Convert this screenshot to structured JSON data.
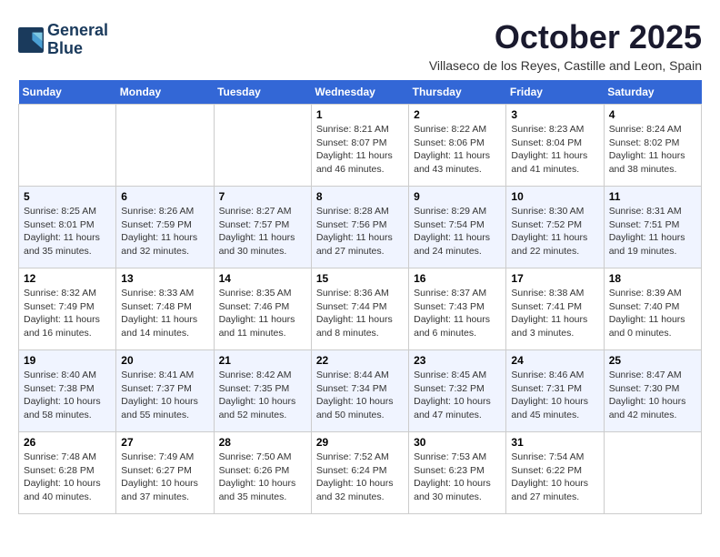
{
  "header": {
    "logo_line1": "General",
    "logo_line2": "Blue",
    "month_title": "October 2025",
    "location": "Villaseco de los Reyes, Castille and Leon, Spain"
  },
  "days_of_week": [
    "Sunday",
    "Monday",
    "Tuesday",
    "Wednesday",
    "Thursday",
    "Friday",
    "Saturday"
  ],
  "weeks": [
    [
      {
        "day": "",
        "info": ""
      },
      {
        "day": "",
        "info": ""
      },
      {
        "day": "",
        "info": ""
      },
      {
        "day": "1",
        "info": "Sunrise: 8:21 AM\nSunset: 8:07 PM\nDaylight: 11 hours and 46 minutes."
      },
      {
        "day": "2",
        "info": "Sunrise: 8:22 AM\nSunset: 8:06 PM\nDaylight: 11 hours and 43 minutes."
      },
      {
        "day": "3",
        "info": "Sunrise: 8:23 AM\nSunset: 8:04 PM\nDaylight: 11 hours and 41 minutes."
      },
      {
        "day": "4",
        "info": "Sunrise: 8:24 AM\nSunset: 8:02 PM\nDaylight: 11 hours and 38 minutes."
      }
    ],
    [
      {
        "day": "5",
        "info": "Sunrise: 8:25 AM\nSunset: 8:01 PM\nDaylight: 11 hours and 35 minutes."
      },
      {
        "day": "6",
        "info": "Sunrise: 8:26 AM\nSunset: 7:59 PM\nDaylight: 11 hours and 32 minutes."
      },
      {
        "day": "7",
        "info": "Sunrise: 8:27 AM\nSunset: 7:57 PM\nDaylight: 11 hours and 30 minutes."
      },
      {
        "day": "8",
        "info": "Sunrise: 8:28 AM\nSunset: 7:56 PM\nDaylight: 11 hours and 27 minutes."
      },
      {
        "day": "9",
        "info": "Sunrise: 8:29 AM\nSunset: 7:54 PM\nDaylight: 11 hours and 24 minutes."
      },
      {
        "day": "10",
        "info": "Sunrise: 8:30 AM\nSunset: 7:52 PM\nDaylight: 11 hours and 22 minutes."
      },
      {
        "day": "11",
        "info": "Sunrise: 8:31 AM\nSunset: 7:51 PM\nDaylight: 11 hours and 19 minutes."
      }
    ],
    [
      {
        "day": "12",
        "info": "Sunrise: 8:32 AM\nSunset: 7:49 PM\nDaylight: 11 hours and 16 minutes."
      },
      {
        "day": "13",
        "info": "Sunrise: 8:33 AM\nSunset: 7:48 PM\nDaylight: 11 hours and 14 minutes."
      },
      {
        "day": "14",
        "info": "Sunrise: 8:35 AM\nSunset: 7:46 PM\nDaylight: 11 hours and 11 minutes."
      },
      {
        "day": "15",
        "info": "Sunrise: 8:36 AM\nSunset: 7:44 PM\nDaylight: 11 hours and 8 minutes."
      },
      {
        "day": "16",
        "info": "Sunrise: 8:37 AM\nSunset: 7:43 PM\nDaylight: 11 hours and 6 minutes."
      },
      {
        "day": "17",
        "info": "Sunrise: 8:38 AM\nSunset: 7:41 PM\nDaylight: 11 hours and 3 minutes."
      },
      {
        "day": "18",
        "info": "Sunrise: 8:39 AM\nSunset: 7:40 PM\nDaylight: 11 hours and 0 minutes."
      }
    ],
    [
      {
        "day": "19",
        "info": "Sunrise: 8:40 AM\nSunset: 7:38 PM\nDaylight: 10 hours and 58 minutes."
      },
      {
        "day": "20",
        "info": "Sunrise: 8:41 AM\nSunset: 7:37 PM\nDaylight: 10 hours and 55 minutes."
      },
      {
        "day": "21",
        "info": "Sunrise: 8:42 AM\nSunset: 7:35 PM\nDaylight: 10 hours and 52 minutes."
      },
      {
        "day": "22",
        "info": "Sunrise: 8:44 AM\nSunset: 7:34 PM\nDaylight: 10 hours and 50 minutes."
      },
      {
        "day": "23",
        "info": "Sunrise: 8:45 AM\nSunset: 7:32 PM\nDaylight: 10 hours and 47 minutes."
      },
      {
        "day": "24",
        "info": "Sunrise: 8:46 AM\nSunset: 7:31 PM\nDaylight: 10 hours and 45 minutes."
      },
      {
        "day": "25",
        "info": "Sunrise: 8:47 AM\nSunset: 7:30 PM\nDaylight: 10 hours and 42 minutes."
      }
    ],
    [
      {
        "day": "26",
        "info": "Sunrise: 7:48 AM\nSunset: 6:28 PM\nDaylight: 10 hours and 40 minutes."
      },
      {
        "day": "27",
        "info": "Sunrise: 7:49 AM\nSunset: 6:27 PM\nDaylight: 10 hours and 37 minutes."
      },
      {
        "day": "28",
        "info": "Sunrise: 7:50 AM\nSunset: 6:26 PM\nDaylight: 10 hours and 35 minutes."
      },
      {
        "day": "29",
        "info": "Sunrise: 7:52 AM\nSunset: 6:24 PM\nDaylight: 10 hours and 32 minutes."
      },
      {
        "day": "30",
        "info": "Sunrise: 7:53 AM\nSunset: 6:23 PM\nDaylight: 10 hours and 30 minutes."
      },
      {
        "day": "31",
        "info": "Sunrise: 7:54 AM\nSunset: 6:22 PM\nDaylight: 10 hours and 27 minutes."
      },
      {
        "day": "",
        "info": ""
      }
    ]
  ]
}
